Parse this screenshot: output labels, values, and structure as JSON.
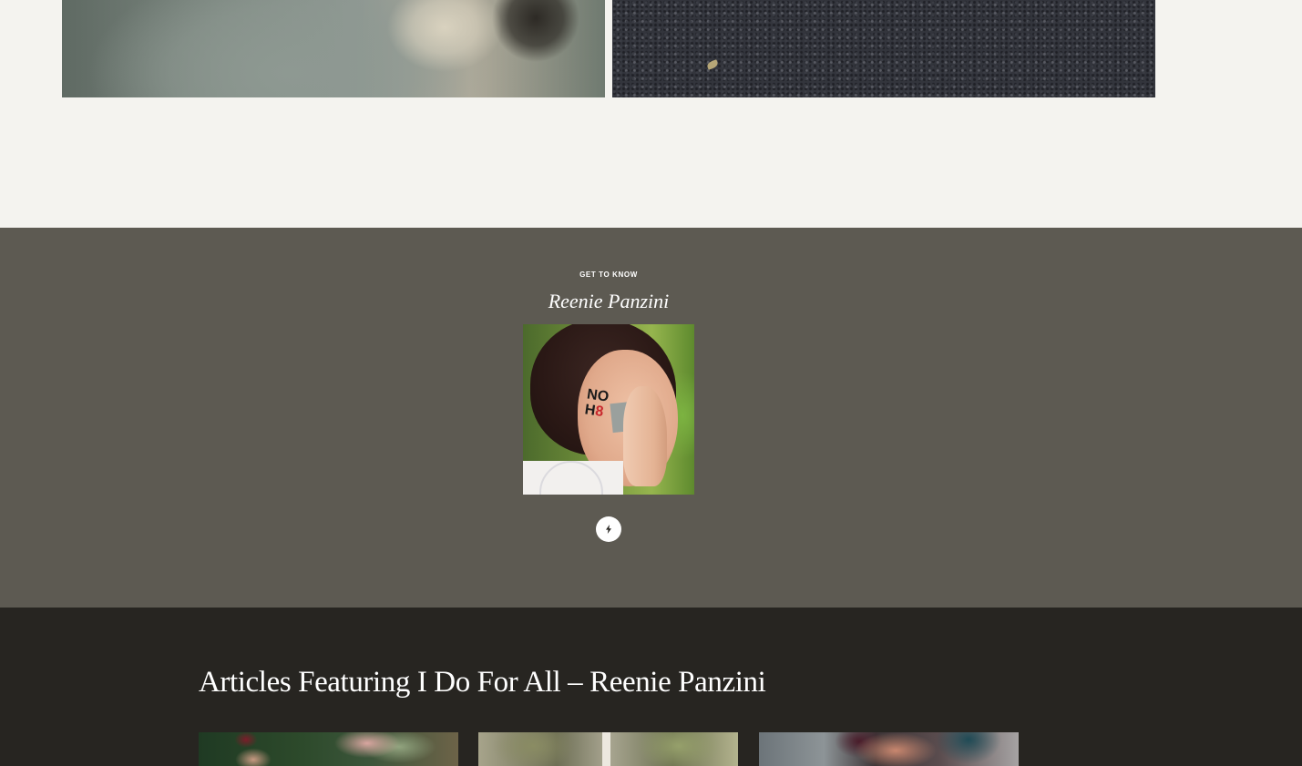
{
  "profile": {
    "eyebrow": "GET TO KNOW",
    "name": "Reenie Panzini",
    "photo_text": {
      "line1": "NO",
      "line2_a": "H",
      "line2_b": "8"
    },
    "social_icon": "bolt-icon"
  },
  "articles": {
    "heading": "Articles Featuring I Do For All – Reenie Panzini",
    "cards": [
      {
        "name": "article-card-1"
      },
      {
        "name": "article-card-2"
      },
      {
        "name": "article-card-3"
      }
    ]
  },
  "colors": {
    "page_background": "#f4f3ef",
    "profile_background": "#5d5a52",
    "articles_background": "#272521",
    "text": "#ffffff"
  }
}
